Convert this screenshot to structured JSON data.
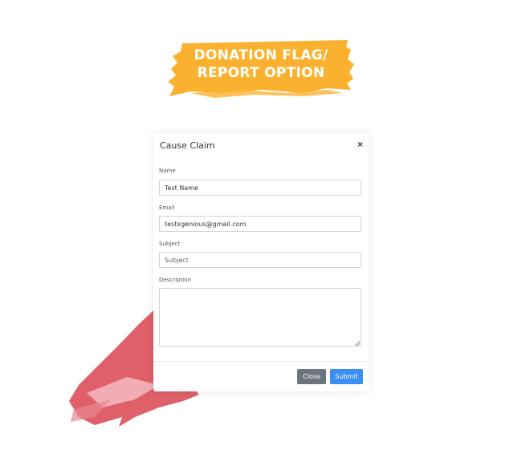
{
  "banner": {
    "line1": "DONATION FLAG/",
    "line2": "REPORT OPTION",
    "color": "#fbb130"
  },
  "modal": {
    "title": "Cause Claim",
    "close_icon": "×",
    "fields": {
      "name": {
        "label": "Name",
        "value": "Test Name"
      },
      "email": {
        "label": "Email",
        "value": "testxgenious@gmail.com"
      },
      "subject": {
        "label": "Subject",
        "placeholder": "Subject",
        "value": ""
      },
      "description": {
        "label": "Description",
        "value": ""
      }
    },
    "buttons": {
      "close": "Close",
      "submit": "Submit"
    }
  },
  "colors": {
    "accent": "#3b8ef3",
    "secondary": "#6c757d",
    "brush": "#d9444f"
  }
}
